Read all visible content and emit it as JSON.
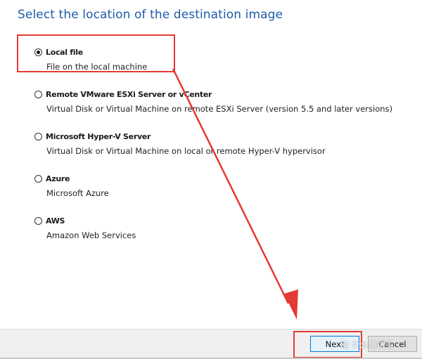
{
  "title": "Select the location of the destination image",
  "options": [
    {
      "label": "Local file",
      "description": "File on the local machine",
      "selected": true
    },
    {
      "label": "Remote VMware ESXi Server or vCenter",
      "description": "Virtual Disk or Virtual Machine on remote ESXi Server (version 5.5 and later versions)",
      "selected": false
    },
    {
      "label": "Microsoft Hyper-V Server",
      "description": "Virtual Disk or Virtual Machine on local or remote Hyper-V hypervisor",
      "selected": false
    },
    {
      "label": "Azure",
      "description": "Microsoft Azure",
      "selected": false
    },
    {
      "label": "AWS",
      "description": "Amazon Web Services",
      "selected": false
    }
  ],
  "buttons": {
    "next_label": "Next",
    "cancel_label": "Cancel"
  },
  "watermark": "值 什么值得买",
  "colors": {
    "title": "#1e5ba8",
    "annotation": "#e53935"
  }
}
